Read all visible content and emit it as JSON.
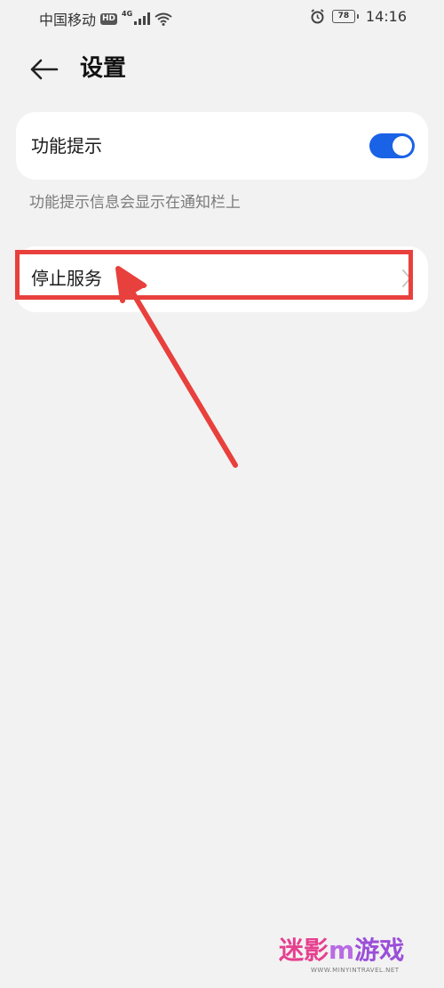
{
  "status_bar": {
    "carrier": "中国移动",
    "hd_badge": "HD",
    "network": "4G",
    "battery": "78",
    "time": "14:16"
  },
  "header": {
    "title": "设置",
    "back_icon": "arrow-left-icon"
  },
  "settings": {
    "feature_tip": {
      "label": "功能提示",
      "enabled": true,
      "description": "功能提示信息会显示在通知栏上"
    },
    "stop_service": {
      "label": "停止服务",
      "icon": "chevron-right-icon"
    }
  },
  "annotation": {
    "color": "#e8403c"
  },
  "watermark": {
    "main_left": "迷影",
    "main_logo": "m",
    "main_right": "游戏",
    "sub": "WWW.MINYINTRAVEL.NET"
  },
  "colors": {
    "background": "#f2f2f2",
    "card": "#ffffff",
    "switch_on": "#1a62e6",
    "description": "#7b7b7b"
  }
}
